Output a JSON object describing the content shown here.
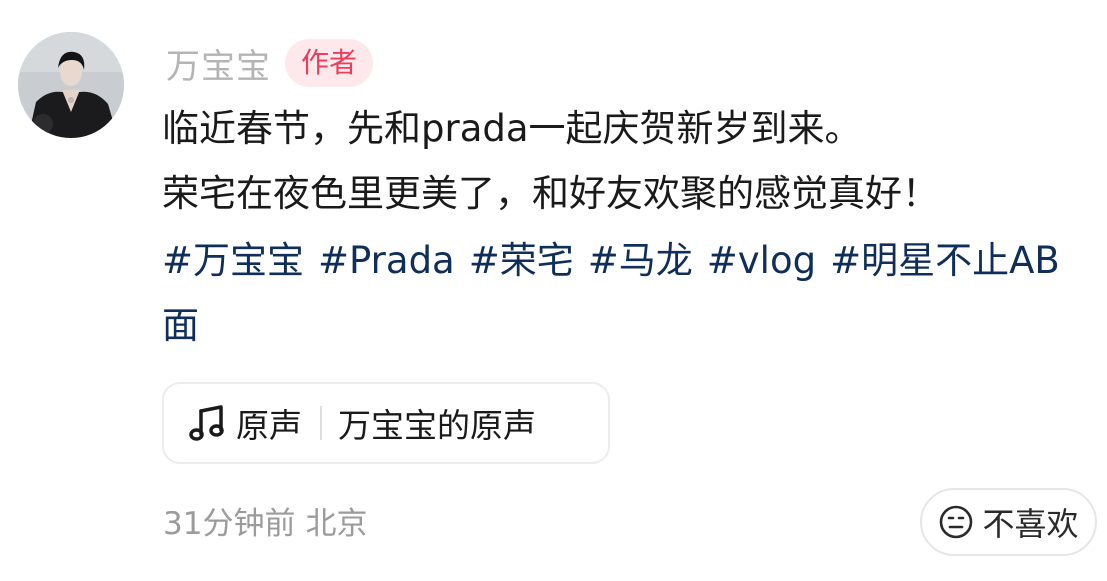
{
  "author": {
    "name": "万宝宝",
    "badge": "作者"
  },
  "post": {
    "lines": [
      "临近春节，先和prada一起庆贺新岁到来。",
      "荣宅在夜色里更美了，和好友欢聚的感觉真好！"
    ],
    "tags": [
      "#万宝宝",
      "#Prada",
      "#荣宅",
      "#马龙",
      "#vlog",
      "#明星不止AB面"
    ]
  },
  "music": {
    "icon": "music-note-icon",
    "label": "原声",
    "title": "万宝宝的原声"
  },
  "meta": {
    "time": "31分钟前",
    "location": "北京"
  },
  "dislike": {
    "icon": "frown-face-icon",
    "label": "不喜欢"
  },
  "colors": {
    "badge_bg": "#fde9ec",
    "badge_text": "#ec3e5b",
    "tag_text": "#0f2f5a",
    "muted_text": "#9b9b9b"
  }
}
